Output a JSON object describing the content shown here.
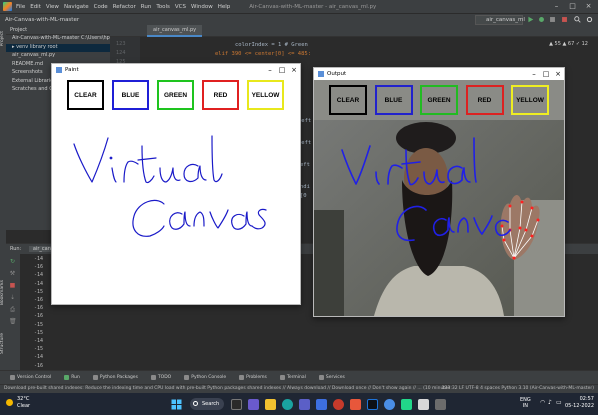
{
  "ide": {
    "menu": [
      "File",
      "Edit",
      "View",
      "Navigate",
      "Code",
      "Refactor",
      "Run",
      "Tools",
      "VCS",
      "Window",
      "Help"
    ],
    "title": "Air-Canvas-with-ML-master - air_canvas_ml.py",
    "breadcrumb": "Air-Canvas-with-ML-master",
    "run_config": "air_canvas_ml",
    "inspection": "▲ 55  ▲ 67  ✓ 12",
    "tab_label": "air_canvas_ml.py"
  },
  "project": {
    "header": "Project",
    "rows": [
      {
        "label": "Air-Canvas-with-ML-master  C:\\Users\\hpsvi\\Downloa",
        "sel": false,
        "dim": false
      },
      {
        "label": "▸ venv  library root",
        "sel": true,
        "dim": false
      },
      {
        "label": "air_canvas_ml.py",
        "sel": false,
        "dim": false
      },
      {
        "label": "README.md",
        "sel": false,
        "dim": false
      },
      {
        "label": "Screenshots",
        "sel": false,
        "dim": false
      },
      {
        "label": "External Libraries",
        "sel": false,
        "dim": false
      },
      {
        "label": "Scratches and Consoles",
        "sel": false,
        "dim": false
      }
    ]
  },
  "code": {
    "line_numbers": [
      "123",
      "124",
      "125",
      "126",
      "127",
      "128",
      "129",
      "130",
      "131",
      "132",
      "133",
      "134",
      "135",
      "136",
      "137",
      "138",
      "139",
      "140",
      "141",
      "142",
      "143"
    ],
    "code_line_1": "colorIndex = 1 # Green",
    "code_line_2": "elif 390 <= center[0] <= 485:",
    "fragment_1": "left",
    "fragment_2": "left",
    "fragment_3": "eft",
    "fragment_4": "ndi",
    "fragment_5": "[0"
  },
  "run_panel": {
    "header": "Run:",
    "tab_label": "air_can...",
    "console_lines": [
      "-14",
      "-16",
      "-14",
      "-14",
      "-15",
      "-16",
      "-16",
      "-16",
      "-15",
      "-15",
      "-14",
      "-15",
      "-14",
      "-16"
    ]
  },
  "bottom_tabs": [
    "Version Control",
    "Run",
    "Python Packages",
    "TODO",
    "Python Console",
    "Problems",
    "Terminal",
    "Services"
  ],
  "side_labels": [
    "Project",
    "Bookmarks",
    "Structure"
  ],
  "status": {
    "message": "Download pre-built shared indexes: Reduce the indexing time and CPU load with pre-built Python packages shared indexes // Always download // Download once // Don't show again // ... (10 minutes",
    "right": "133:32   LF   UTF-8   4 spaces   Python 3.10 (Air-Canvas-with-ML-master)"
  },
  "paint_window": {
    "title": "Paint",
    "buttons": [
      {
        "label": "CLEAR",
        "color": "#000000"
      },
      {
        "label": "BLUE",
        "color": "#1f1fd6"
      },
      {
        "label": "GREEN",
        "color": "#1ec41e"
      },
      {
        "label": "RED",
        "color": "#e02020"
      },
      {
        "label": "YELLOW",
        "color": "#e8e81c"
      }
    ],
    "ink_color": "#1a1ac8"
  },
  "output_window": {
    "title": "Output",
    "buttons": [
      {
        "label": "CLEAR",
        "color": "#000000"
      },
      {
        "label": "BLUE",
        "color": "#2222cc"
      },
      {
        "label": "GREEN",
        "color": "#22bb22"
      },
      {
        "label": "RED",
        "color": "#dd2222"
      },
      {
        "label": "YELLOW",
        "color": "#eeee22"
      }
    ]
  },
  "taskbar": {
    "weather_temp": "32°C",
    "weather_desc": "Clear",
    "search_label": "Search",
    "lang_top": "ENG",
    "lang_bottom": "IN",
    "time": "02:57",
    "date": "05-12-2022"
  },
  "colors": {
    "ide_bg": "#2b2b2b",
    "ide_panel": "#3c3f41",
    "taskbar": "#1f2633",
    "accent": "#4a88c7"
  }
}
